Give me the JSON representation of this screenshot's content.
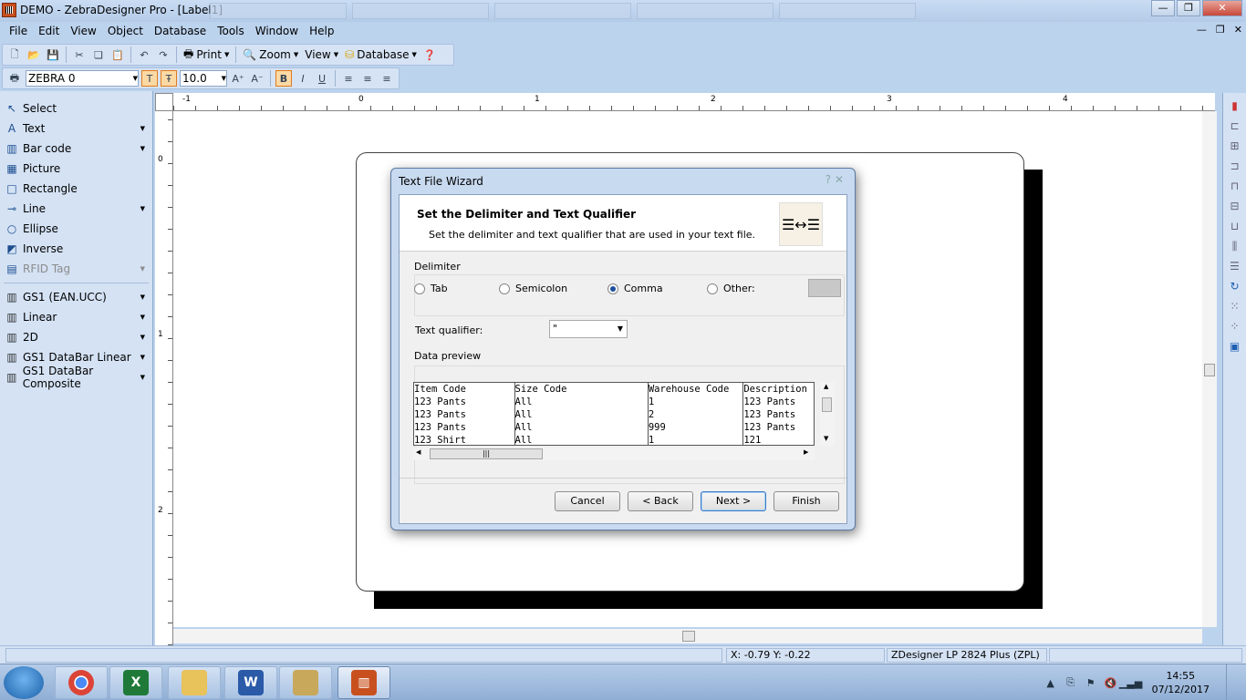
{
  "window": {
    "title": "DEMO - ZebraDesigner Pro - [Label1]"
  },
  "menu": [
    "File",
    "Edit",
    "View",
    "Object",
    "Database",
    "Tools",
    "Window",
    "Help"
  ],
  "toolbar1": {
    "print_label": "Print",
    "zoom_label": "Zoom",
    "view_label": "View",
    "database_label": "Database"
  },
  "toolbar2": {
    "printer": "ZEBRA 0",
    "font_size": "10.0"
  },
  "tools": [
    {
      "label": "Select",
      "icon": "cursor-icon",
      "glyph": "↖",
      "arrow": false,
      "disabled": false
    },
    {
      "label": "Text",
      "icon": "text-icon",
      "glyph": "A",
      "arrow": true,
      "disabled": false
    },
    {
      "label": "Bar code",
      "icon": "barcode-icon",
      "glyph": "▥",
      "arrow": true,
      "disabled": false
    },
    {
      "label": "Picture",
      "icon": "picture-icon",
      "glyph": "▦",
      "arrow": false,
      "disabled": false
    },
    {
      "label": "Rectangle",
      "icon": "rectangle-icon",
      "glyph": "□",
      "arrow": false,
      "disabled": false
    },
    {
      "label": "Line",
      "icon": "line-icon",
      "glyph": "⊸",
      "arrow": true,
      "disabled": false
    },
    {
      "label": "Ellipse",
      "icon": "ellipse-icon",
      "glyph": "○",
      "arrow": false,
      "disabled": false
    },
    {
      "label": "Inverse",
      "icon": "inverse-icon",
      "glyph": "◩",
      "arrow": false,
      "disabled": false
    },
    {
      "label": "RFID Tag",
      "icon": "rfid-icon",
      "glyph": "▤",
      "arrow": true,
      "disabled": true
    }
  ],
  "barcode_tools": [
    {
      "label": "GS1 (EAN.UCC)",
      "icon": "barcode-icon"
    },
    {
      "label": "Linear",
      "icon": "barcode-icon"
    },
    {
      "label": "2D",
      "icon": "barcode-2d-icon"
    },
    {
      "label": "GS1 DataBar Linear",
      "icon": "barcode-icon"
    },
    {
      "label": "GS1 DataBar Composite",
      "icon": "barcode-icon"
    }
  ],
  "ruler": {
    "h_numbers": [
      "-1",
      "0",
      "1",
      "2",
      "3",
      "4"
    ],
    "v_numbers": [
      "0",
      "1",
      "2"
    ]
  },
  "status": {
    "coords": "X: -0.79 Y: -0.22",
    "printer": "ZDesigner LP 2824 Plus (ZPL)"
  },
  "dialog": {
    "title": "Text File Wizard",
    "heading": "Set the Delimiter and Text Qualifier",
    "subheading": "Set the delimiter and text qualifier that are used in your text file.",
    "delimiter_group": "Delimiter",
    "delimiters": [
      {
        "label": "Tab",
        "checked": false
      },
      {
        "label": "Semicolon",
        "checked": false
      },
      {
        "label": "Comma",
        "checked": true
      },
      {
        "label": "Other:",
        "checked": false
      }
    ],
    "qualifier_label": "Text qualifier:",
    "qualifier_value": "\"",
    "preview_label": "Data preview",
    "preview_columns": [
      "Item Code",
      "Size Code",
      "Warehouse Code",
      "Description"
    ],
    "preview_rows": [
      [
        "123 Pants",
        "All",
        "1",
        "123 Pants"
      ],
      [
        "123 Pants",
        "All",
        "2",
        "123 Pants"
      ],
      [
        "123 Pants",
        "All",
        "999",
        "123 Pants"
      ],
      [
        "123 Shirt",
        "All",
        "1",
        "121"
      ]
    ],
    "buttons": {
      "cancel": "Cancel",
      "back": "< Back",
      "next": "Next >",
      "finish": "Finish"
    }
  },
  "taskbar": {
    "time": "14:55",
    "date": "07/12/2017"
  }
}
